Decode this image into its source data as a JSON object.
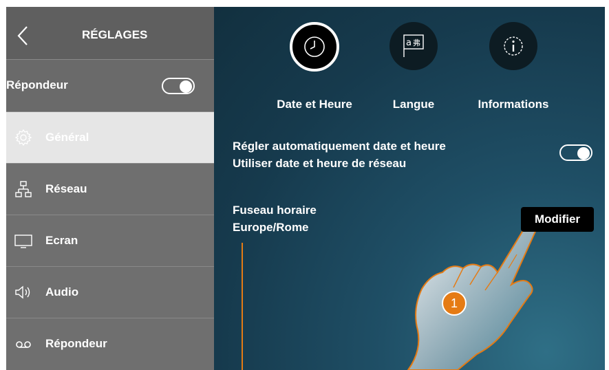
{
  "sidebar": {
    "back_icon": "chevron-left-icon",
    "title": "RÉGLAGES",
    "answering_toggle_label": "Répondeur",
    "items": [
      {
        "label": "Général",
        "icon": "gear-icon",
        "active": true
      },
      {
        "label": "Réseau",
        "icon": "network-icon"
      },
      {
        "label": "Ecran",
        "icon": "monitor-icon"
      },
      {
        "label": "Audio",
        "icon": "speaker-icon"
      },
      {
        "label": "Répondeur",
        "icon": "voicemail-icon"
      }
    ]
  },
  "tabs": [
    {
      "label": "Date et Heure",
      "icon": "clock-icon",
      "active": true
    },
    {
      "label": "Langue",
      "icon": "language-icon"
    },
    {
      "label": "Informations",
      "icon": "info-icon"
    }
  ],
  "settings": {
    "auto_datetime_line1": "Régler automatiquement date et heure",
    "auto_datetime_line2": "Utiliser date et heure de réseau",
    "timezone_label": "Fuseau horaire",
    "timezone_value": "Europe/Rome",
    "modify_button": "Modifier"
  },
  "callout_number": "1",
  "colors": {
    "accent": "#e57b14",
    "sidebar": "#6f6f6f",
    "active_item": "#e6e6e6"
  }
}
